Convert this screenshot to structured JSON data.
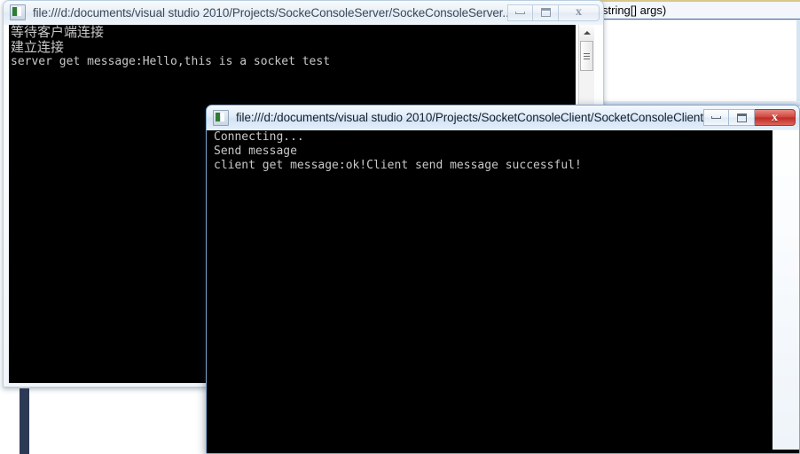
{
  "desktop": {
    "background_color": "#ffffff",
    "accent_bar_color": "#2d3a55"
  },
  "background_window": {
    "name": "visual-studio-editor",
    "code_fragment": "string[] args)",
    "editor_background": "#ffffff"
  },
  "windows": [
    {
      "id": "server-console",
      "title": "file:///d:/documents/visual studio 2010/Projects/SockeConsoleServer/SockeConsoleServer...",
      "state": "inactive",
      "icon": "console-app-icon",
      "buttons": {
        "minimize": "Minimize",
        "maximize": "Maximize",
        "close": "Close"
      },
      "console_lines": [
        {
          "text": "等待客户端连接",
          "script": "cjk"
        },
        {
          "text": "建立连接",
          "script": "cjk"
        },
        {
          "text": "server get message:Hello,this is a socket test",
          "script": "latin"
        }
      ],
      "scrollbar": {
        "up_arrow": "scroll-up-arrow",
        "thumb": "scroll-thumb"
      }
    },
    {
      "id": "client-console",
      "title": "file:///d:/documents/visual studio 2010/Projects/SocketConsoleClient/SocketConsoleClient...",
      "state": "active",
      "icon": "console-app-icon",
      "buttons": {
        "minimize": "Minimize",
        "maximize": "Maximize",
        "close": "Close"
      },
      "console_lines": [
        {
          "text": "Connecting...",
          "script": "latin"
        },
        {
          "text": "Send message",
          "script": "latin"
        },
        {
          "text": "client get message:ok!Client send message successful!",
          "script": "latin"
        }
      ],
      "scrollbar": {
        "up_arrow": "scroll-up-arrow",
        "thumb": "scroll-thumb"
      }
    }
  ]
}
